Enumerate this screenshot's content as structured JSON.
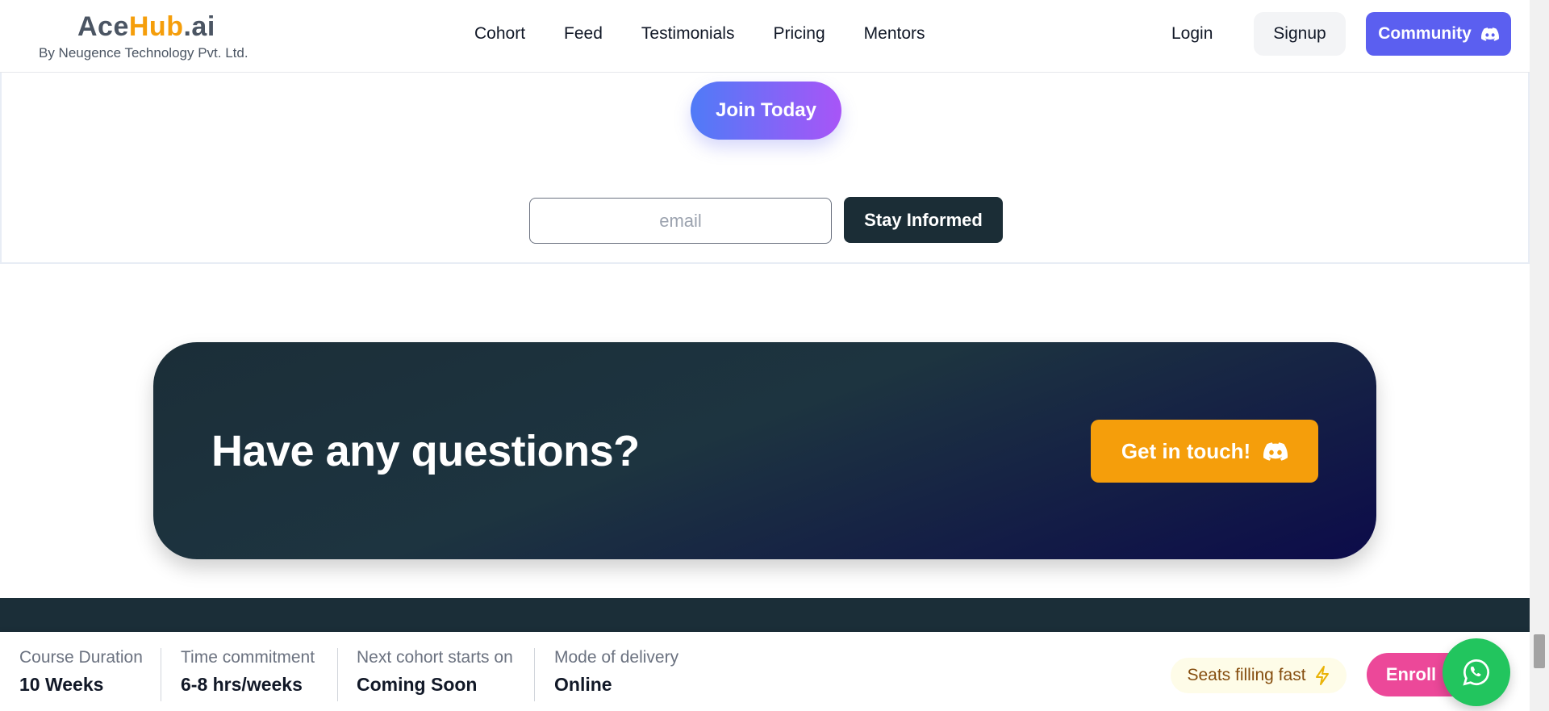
{
  "header": {
    "logo": {
      "ace": "Ace",
      "hub": "Hub",
      "ai": ".ai",
      "subtitle": "By Neugence Technology Pvt. Ltd."
    },
    "nav": [
      "Cohort",
      "Feed",
      "Testimonials",
      "Pricing",
      "Mentors"
    ],
    "login_label": "Login",
    "signup_label": "Signup",
    "community_label": "Community",
    "community_icon": "discord-icon"
  },
  "cta": {
    "join_label": "Join Today",
    "email_placeholder": "email",
    "email_value": "",
    "stay_label": "Stay Informed"
  },
  "questions": {
    "title": "Have any questions?",
    "button_label": "Get in touch!",
    "button_icon": "discord-icon"
  },
  "bottom_bar": {
    "stats": [
      {
        "label": "Course Duration",
        "value": "10 Weeks"
      },
      {
        "label": "Time commitment",
        "value": "6-8 hrs/weeks"
      },
      {
        "label": "Next cohort starts on",
        "value": "Coming Soon"
      },
      {
        "label": "Mode of delivery",
        "value": "Online"
      }
    ],
    "seats_label": "Seats filling fast",
    "seats_icon": "lightning-icon",
    "enroll_label": "Enroll"
  },
  "colors": {
    "brand_orange": "#f59e0b",
    "community_blue": "#5b5ff0",
    "dark_teal": "#1b2d36",
    "enroll_pink": "#ec4899",
    "whatsapp_green": "#22c55e"
  }
}
